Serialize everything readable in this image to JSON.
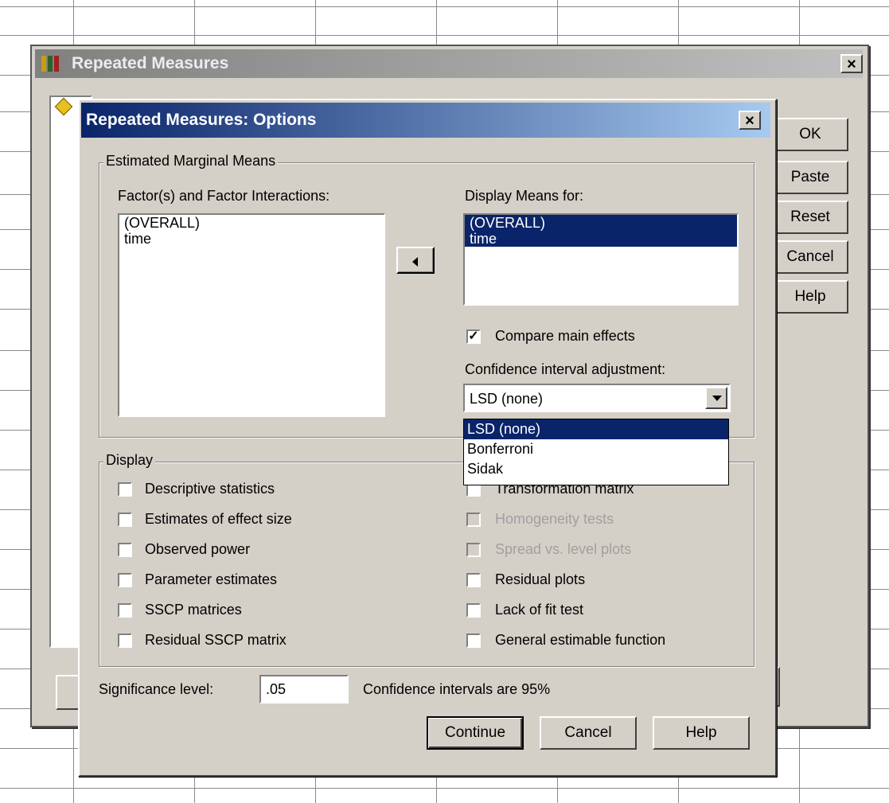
{
  "outer_dialog": {
    "title": "Repeated Measures",
    "close_label": "×",
    "buttons": [
      "OK",
      "Paste",
      "Reset",
      "Cancel",
      "Help"
    ]
  },
  "options_dialog": {
    "title": "Repeated Measures: Options",
    "close_label": "×",
    "emm_group": {
      "legend": "Estimated Marginal Means",
      "factors_label": "Factor(s) and Factor Interactions:",
      "factors": [
        "(OVERALL)",
        "time"
      ],
      "display_means_label": "Display Means for:",
      "display_means": [
        "(OVERALL)",
        "time"
      ],
      "compare_main_effects_label": "Compare main effects",
      "compare_main_effects_checked": true,
      "ci_adjustment_label": "Confidence interval adjustment:",
      "ci_adjustment_value": "LSD (none)",
      "ci_adjustment_options": [
        "LSD (none)",
        "Bonferroni",
        "Sidak"
      ]
    },
    "display_group": {
      "legend": "Display",
      "left_options": [
        "Descriptive statistics",
        "Estimates of effect size",
        "Observed power",
        "Parameter estimates",
        "SSCP matrices",
        "Residual SSCP matrix"
      ],
      "right_options": [
        "Transformation matrix",
        "Homogeneity tests",
        "Spread vs. level plots",
        "Residual plots",
        "Lack of fit test",
        "General estimable function"
      ],
      "right_disabled": [
        false,
        true,
        true,
        false,
        false,
        false
      ]
    },
    "significance_label": "Significance level:",
    "significance_value": ".05",
    "ci_note": "Confidence intervals are 95%",
    "buttons": {
      "continue": "Continue",
      "cancel": "Cancel",
      "help": "Help"
    }
  },
  "colors": {
    "active_title": "#0a246a",
    "inactive_title": "#808080",
    "dialog_bg": "#d4d0c8",
    "selection": "#0a246a"
  }
}
